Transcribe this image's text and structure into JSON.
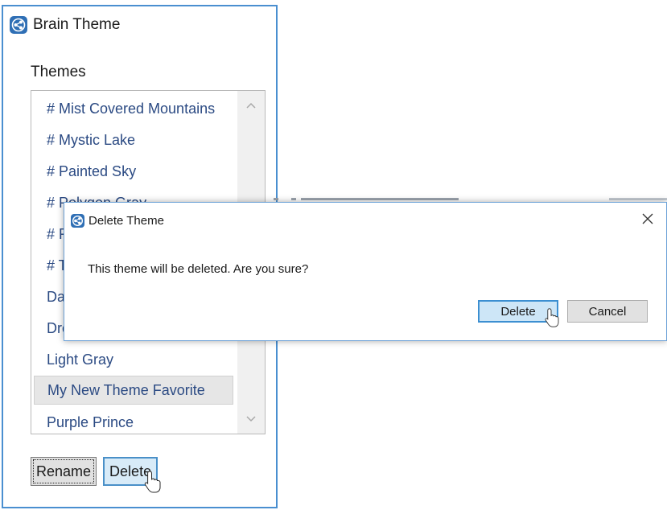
{
  "main_window": {
    "title": "Brain Theme",
    "icon": "brain-app-icon",
    "themes_label": "Themes",
    "themes": [
      {
        "label": "# Mist Covered Mountains",
        "selected": false
      },
      {
        "label": "# Mystic Lake",
        "selected": false
      },
      {
        "label": "# Painted Sky",
        "selected": false
      },
      {
        "label": "# Polygon Gray",
        "selected": false
      },
      {
        "label": "# R",
        "selected": false
      },
      {
        "label": "# T",
        "selected": false
      },
      {
        "label": "Da",
        "selected": false
      },
      {
        "label": "Dre",
        "selected": false
      },
      {
        "label": "Light Gray",
        "selected": false
      },
      {
        "label": "My New Theme Favorite",
        "selected": true
      },
      {
        "label": "Purple Prince",
        "selected": false
      }
    ],
    "scroll_up_icon": "chevron-up-icon",
    "scroll_down_icon": "chevron-down-icon",
    "buttons": {
      "rename_label": "Rename",
      "delete_label": "Delete"
    }
  },
  "dialog": {
    "title": "Delete Theme",
    "icon": "brain-app-icon",
    "close_icon": "close-icon",
    "message": "This theme will be deleted. Are you sure?",
    "buttons": {
      "delete_label": "Delete",
      "cancel_label": "Cancel"
    }
  },
  "colors": {
    "accent_border": "#4a8fd0",
    "list_text": "#2b4a83",
    "button_focus_bg": "#cde6f7",
    "icon_bg": "#2f6fb5"
  }
}
